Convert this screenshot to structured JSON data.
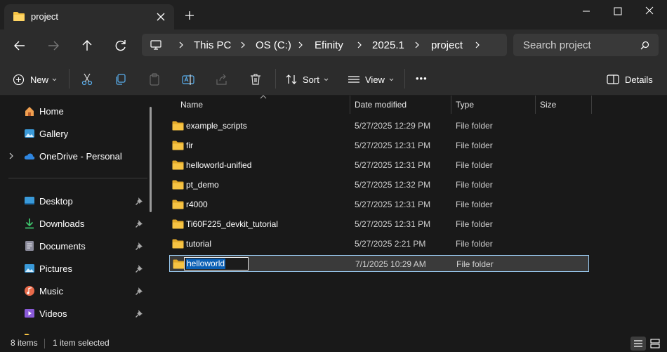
{
  "window": {
    "tab_title": "project",
    "new_tab_label": "+"
  },
  "address": {
    "crumbs": [
      "This PC",
      "OS (C:)",
      "Efinity",
      "2025.1",
      "project"
    ]
  },
  "search": {
    "placeholder": "Search project"
  },
  "toolbar": {
    "new_label": "New",
    "sort_label": "Sort",
    "view_label": "View",
    "more_label": "•••",
    "details_label": "Details"
  },
  "nav": {
    "home": "Home",
    "gallery": "Gallery",
    "onedrive": "OneDrive - Personal",
    "pinned": [
      {
        "label": "Desktop",
        "icon": "desktop-icon",
        "color": "#3a9ad9"
      },
      {
        "label": "Downloads",
        "icon": "download-icon",
        "color": "#3ec46d"
      },
      {
        "label": "Documents",
        "icon": "document-icon",
        "color": "#8a8a9a"
      },
      {
        "label": "Pictures",
        "icon": "pictures-icon",
        "color": "#3a9ad9"
      },
      {
        "label": "Music",
        "icon": "music-icon",
        "color": "#e86a4a"
      },
      {
        "label": "Videos",
        "icon": "video-icon",
        "color": "#8a5ad9"
      }
    ]
  },
  "columns": {
    "name": "Name",
    "date": "Date modified",
    "type": "Type",
    "size": "Size"
  },
  "files": [
    {
      "name": "example_scripts",
      "date": "5/27/2025 12:29 PM",
      "type": "File folder"
    },
    {
      "name": "fir",
      "date": "5/27/2025 12:31 PM",
      "type": "File folder"
    },
    {
      "name": "helloworld-unified",
      "date": "5/27/2025 12:31 PM",
      "type": "File folder"
    },
    {
      "name": "pt_demo",
      "date": "5/27/2025 12:32 PM",
      "type": "File folder"
    },
    {
      "name": "r4000",
      "date": "5/27/2025 12:31 PM",
      "type": "File folder"
    },
    {
      "name": "Ti60F225_devkit_tutorial",
      "date": "5/27/2025 12:31 PM",
      "type": "File folder"
    },
    {
      "name": "tutorial",
      "date": "5/27/2025 2:21 PM",
      "type": "File folder"
    }
  ],
  "renaming": {
    "name": "helloworld",
    "date": "7/1/2025 10:29 AM",
    "type": "File folder"
  },
  "status": {
    "count": "8 items",
    "selection": "1 item selected"
  },
  "colors": {
    "folder": "#f6c343",
    "selection_border": "#99c9ef",
    "text_selection": "#0a5fb4"
  }
}
